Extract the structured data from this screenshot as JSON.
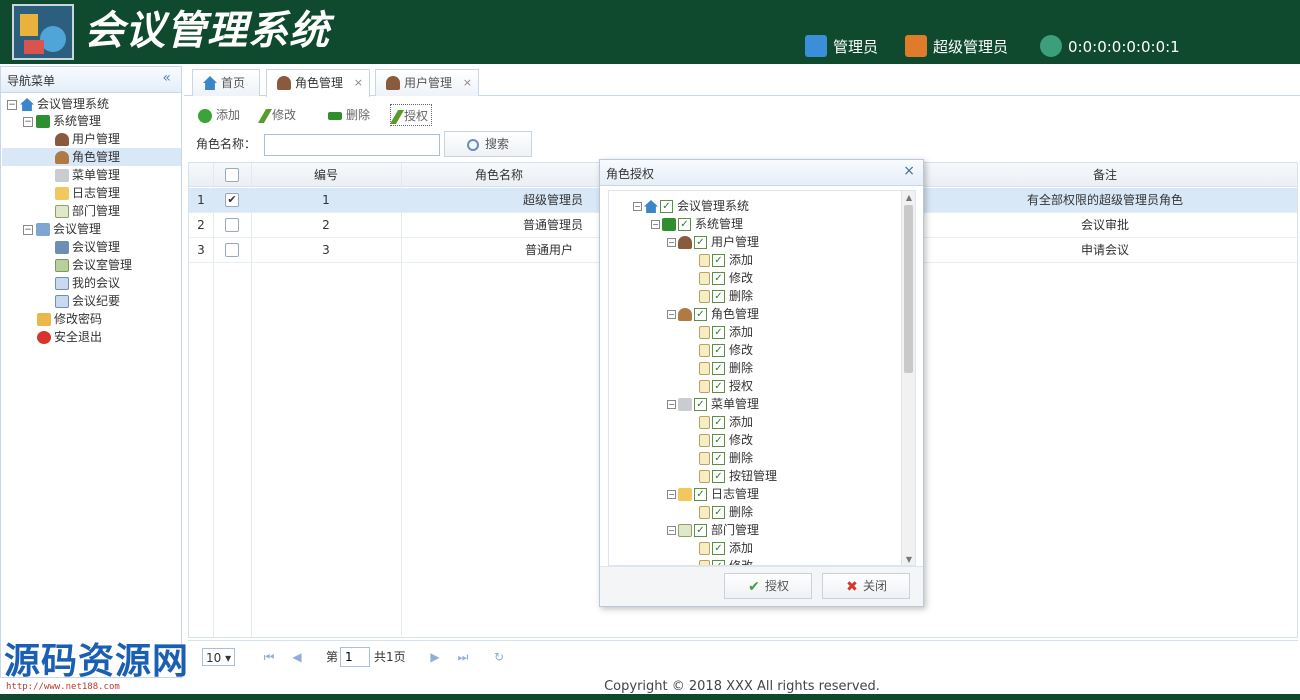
{
  "header": {
    "title": "会议管理系统",
    "user": "管理员",
    "role": "超级管理员",
    "ip": "0:0:0:0:0:0:0:1"
  },
  "sidebar": {
    "title": "导航菜单",
    "collapse_icon": "double-left-arrow-icon",
    "items": [
      {
        "label": "会议管理系统",
        "icon": "home-icon"
      },
      {
        "label": "系统管理",
        "icon": "green-square-icon"
      },
      {
        "label": "用户管理",
        "icon": "user-icon"
      },
      {
        "label": "角色管理",
        "icon": "role-user-icon"
      },
      {
        "label": "菜单管理",
        "icon": "menu-tree-icon"
      },
      {
        "label": "日志管理",
        "icon": "folder-icon"
      },
      {
        "label": "部门管理",
        "icon": "table-icon"
      },
      {
        "label": "会议管理",
        "icon": "monitor-icon"
      },
      {
        "label": "会议管理",
        "icon": "copy-icon"
      },
      {
        "label": "会议室管理",
        "icon": "grid-icon"
      },
      {
        "label": "我的会议",
        "icon": "window-icon"
      },
      {
        "label": "会议纪要",
        "icon": "window-icon"
      },
      {
        "label": "修改密码",
        "icon": "key-folder-icon"
      },
      {
        "label": "安全退出",
        "icon": "exit-icon"
      }
    ]
  },
  "tabs": [
    {
      "label": "首页",
      "icon": "home-icon",
      "closable": false
    },
    {
      "label": "角色管理",
      "icon": "user-icon",
      "closable": true,
      "close": "×"
    },
    {
      "label": "用户管理",
      "icon": "user-icon",
      "closable": true,
      "close": "×"
    }
  ],
  "toolbar": {
    "add": "添加",
    "edit": "修改",
    "delete": "删除",
    "grant": "授权"
  },
  "search": {
    "label": "角色名称：",
    "value": "",
    "button": "搜索"
  },
  "grid": {
    "columns": [
      "",
      "",
      "编号",
      "角色名称",
      "备注"
    ],
    "rows": [
      {
        "row": "1",
        "checked": true,
        "id": "1",
        "name": "超级管理员",
        "remark": "有全部权限的超级管理员角色"
      },
      {
        "row": "2",
        "checked": false,
        "id": "2",
        "name": "普通管理员",
        "remark": "会议审批"
      },
      {
        "row": "3",
        "checked": false,
        "id": "3",
        "name": "普通用户",
        "remark": "申请会议"
      }
    ]
  },
  "pager": {
    "page_size": "10",
    "page_prefix": "第",
    "page_value": "1",
    "total": "共1页"
  },
  "footer": "Copyright © 2018 XXX All rights reserved.",
  "dialog": {
    "title": "角色授权",
    "close": "×",
    "tree": [
      {
        "label": "会议管理系统",
        "level": 0,
        "icon": "home-icon"
      },
      {
        "label": "系统管理",
        "level": 1,
        "icon": "green-square-icon"
      },
      {
        "label": "用户管理",
        "level": 2,
        "icon": "user-icon"
      },
      {
        "label": "添加",
        "level": 3,
        "icon": "doc-icon"
      },
      {
        "label": "修改",
        "level": 3,
        "icon": "doc-icon"
      },
      {
        "label": "删除",
        "level": 3,
        "icon": "doc-icon"
      },
      {
        "label": "角色管理",
        "level": 2,
        "icon": "role-user-icon"
      },
      {
        "label": "添加",
        "level": 3,
        "icon": "doc-icon"
      },
      {
        "label": "修改",
        "level": 3,
        "icon": "doc-icon"
      },
      {
        "label": "删除",
        "level": 3,
        "icon": "doc-icon"
      },
      {
        "label": "授权",
        "level": 3,
        "icon": "doc-icon"
      },
      {
        "label": "菜单管理",
        "level": 2,
        "icon": "menu-tree-icon"
      },
      {
        "label": "添加",
        "level": 3,
        "icon": "doc-icon"
      },
      {
        "label": "修改",
        "level": 3,
        "icon": "doc-icon"
      },
      {
        "label": "删除",
        "level": 3,
        "icon": "doc-icon"
      },
      {
        "label": "按钮管理",
        "level": 3,
        "icon": "doc-icon"
      },
      {
        "label": "日志管理",
        "level": 2,
        "icon": "folder-icon"
      },
      {
        "label": "删除",
        "level": 3,
        "icon": "doc-icon"
      },
      {
        "label": "部门管理",
        "level": 2,
        "icon": "table-icon"
      },
      {
        "label": "添加",
        "level": 3,
        "icon": "doc-icon"
      },
      {
        "label": "修改",
        "level": 3,
        "icon": "doc-icon"
      }
    ],
    "ok": "授权",
    "cancel": "关闭"
  },
  "watermark": {
    "text": "源码资源网",
    "url": "http://www.net188.com"
  },
  "colors": {
    "header_bg": "#0f4a2e",
    "selection": "#d9e8f7",
    "border": "#c7d7e6"
  }
}
